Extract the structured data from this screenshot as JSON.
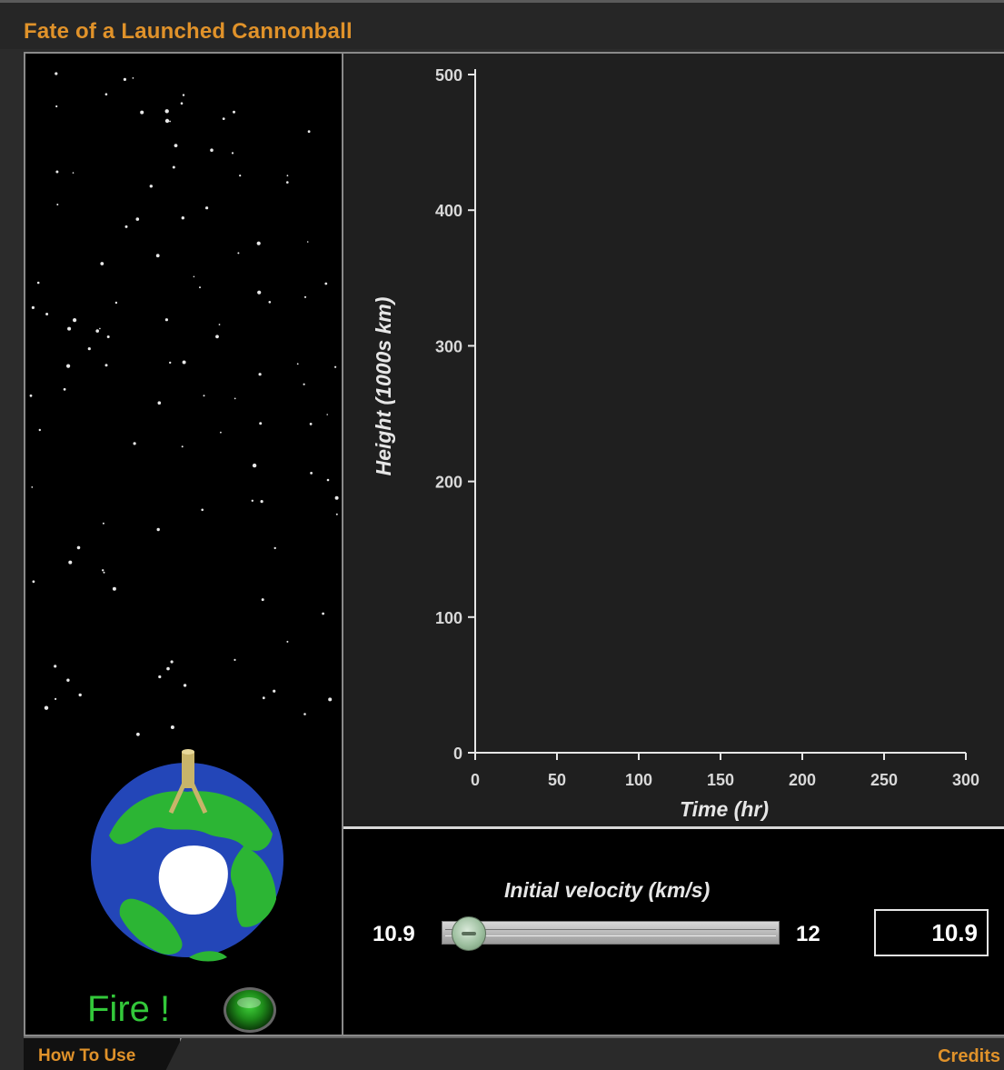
{
  "title": "Fate of a Launched Cannonball",
  "fire_label": "Fire !",
  "velocity": {
    "label": "Initial velocity (km/s)",
    "min_label": "10.9",
    "max_label": "12",
    "min": 10.9,
    "max": 12,
    "value": 10.9,
    "input_value": "10.9"
  },
  "footer": {
    "how_to_use": "How To Use",
    "credits": "Credits"
  },
  "colors": {
    "title": "#e0922a",
    "fire": "#33c83a",
    "ocean": "#2346b8",
    "land": "#2cb534",
    "ice": "#ffffff"
  },
  "chart_data": {
    "type": "line",
    "xlabel": "Time (hr)",
    "ylabel": "Height (1000s km)",
    "xlim": [
      0,
      300
    ],
    "ylim": [
      0,
      500
    ],
    "x_ticks": [
      0,
      50,
      100,
      150,
      200,
      250,
      300
    ],
    "y_ticks": [
      0,
      100,
      200,
      300,
      400,
      500
    ],
    "series": []
  }
}
